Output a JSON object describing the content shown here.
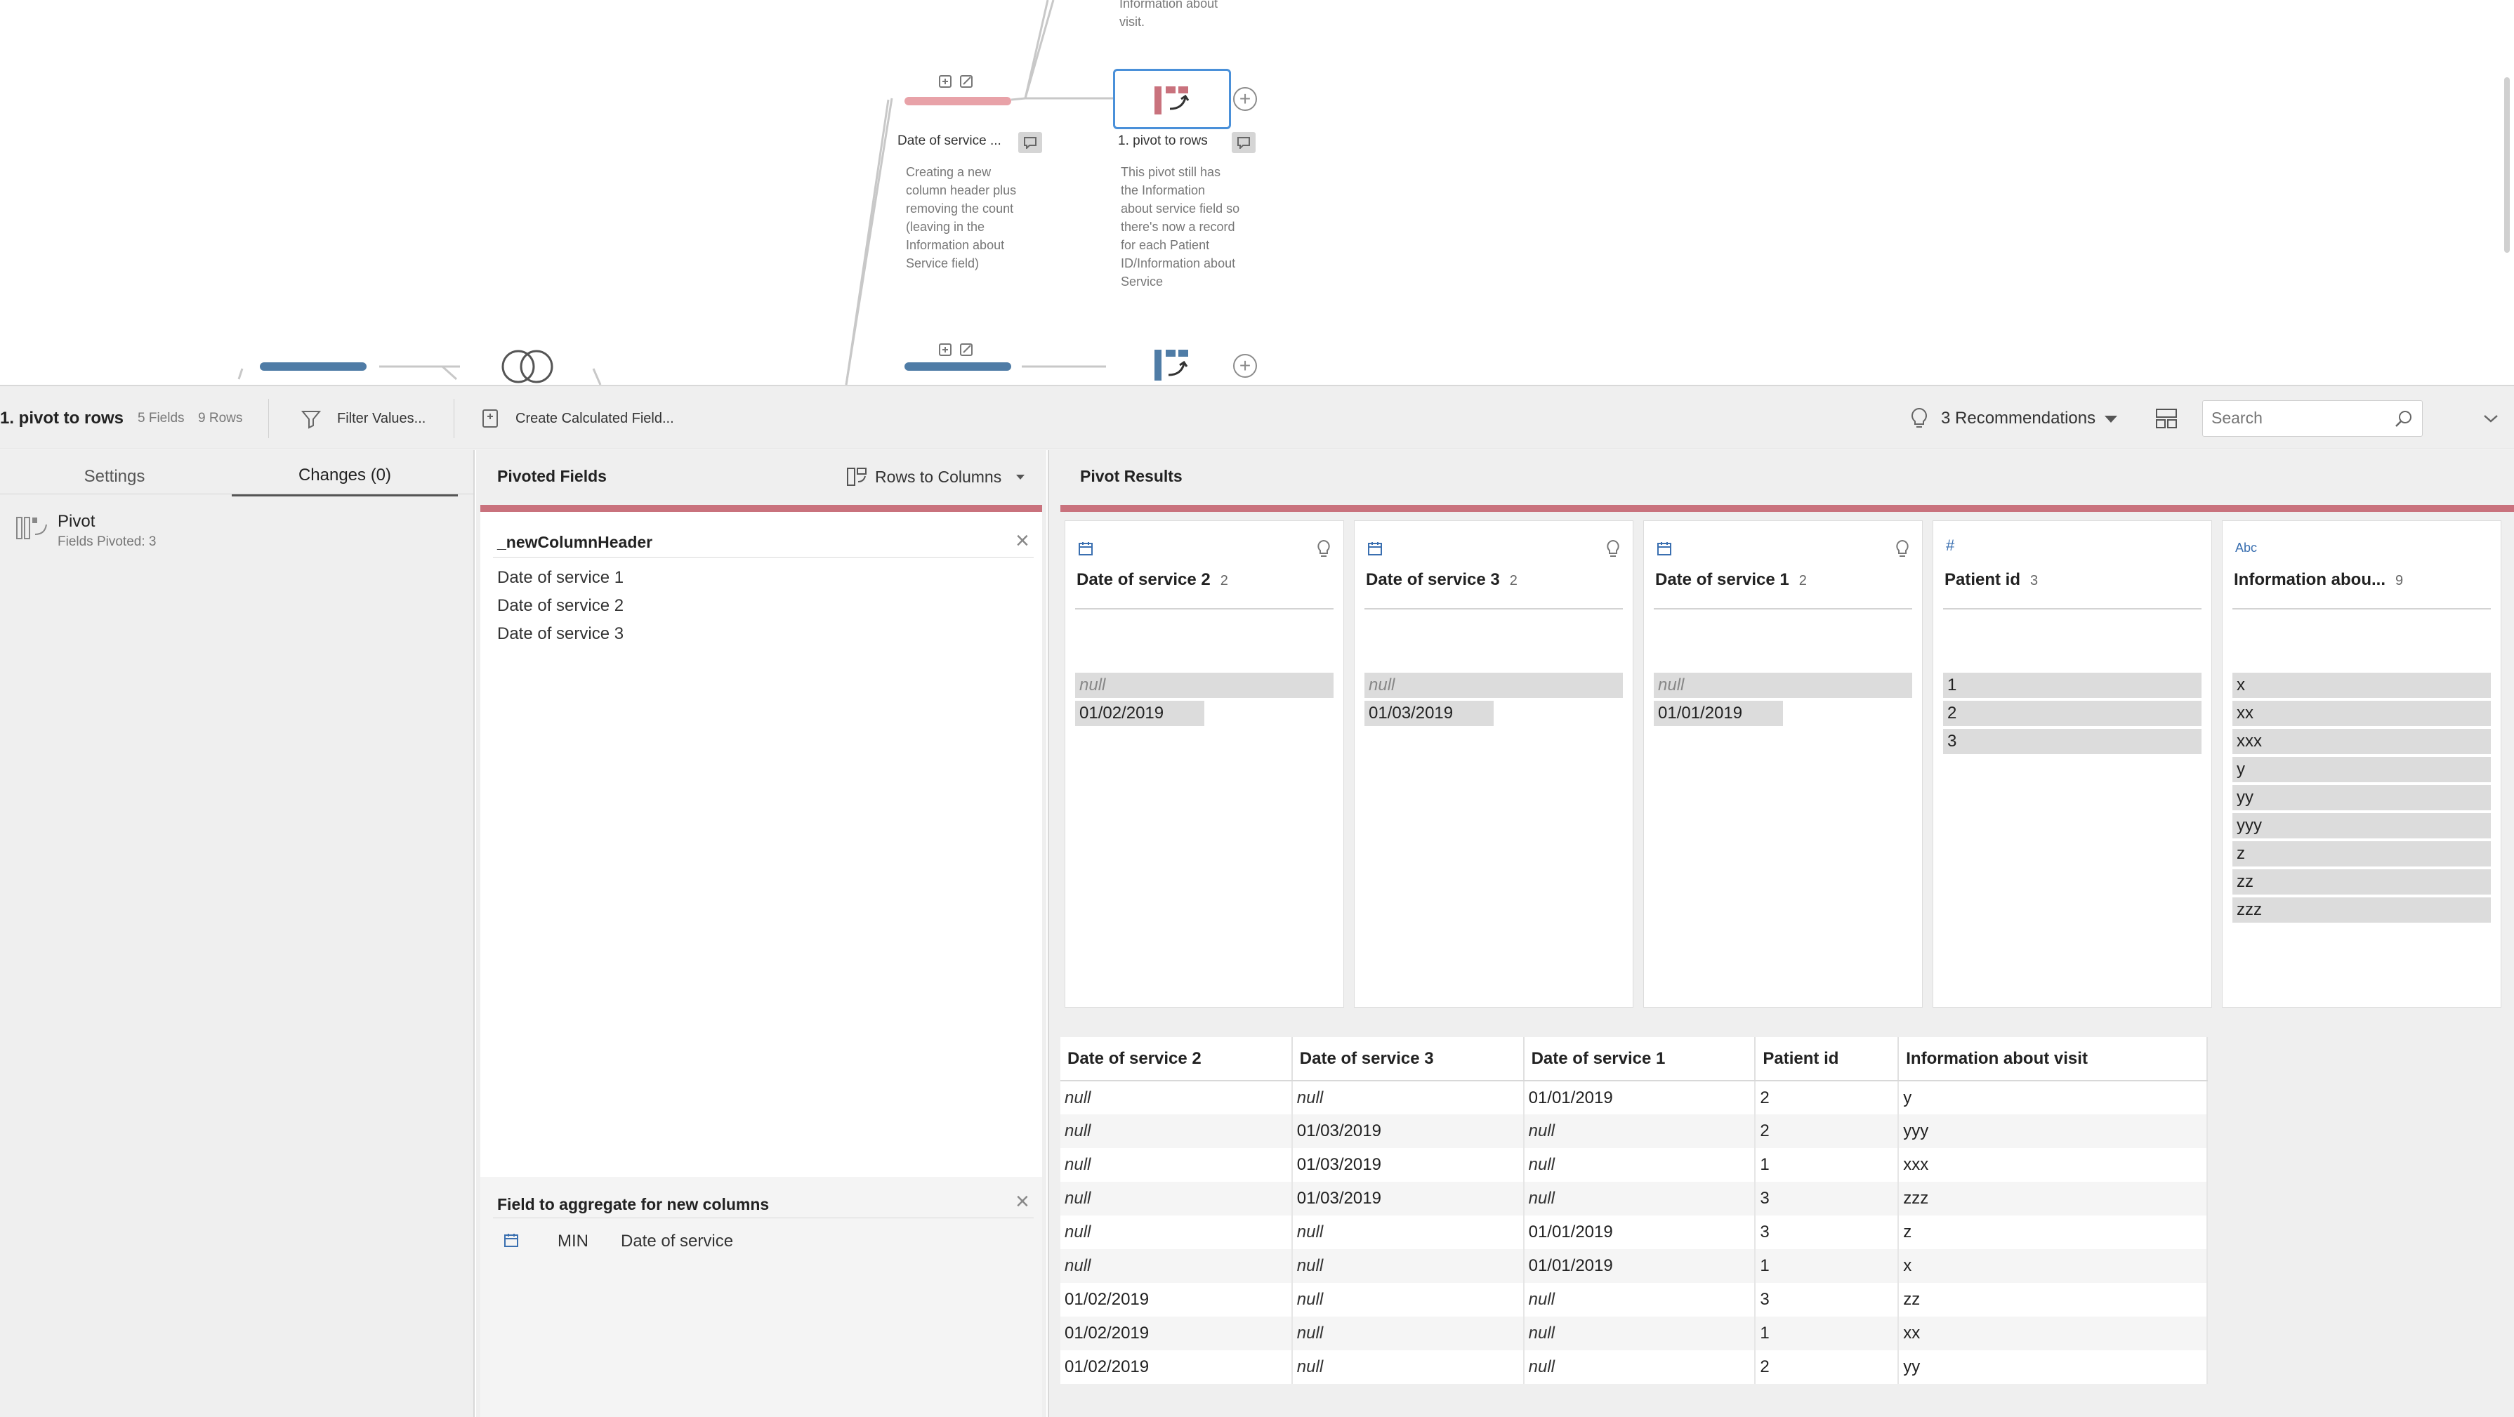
{
  "canvas": {
    "top_note": "Information about\nvisit.",
    "step1": {
      "label": "Date of service ...",
      "note": "Creating a new\ncolumn header plus\nremoving the count\n(leaving in the\nInformation about\nService field)"
    },
    "step2": {
      "label": "1. pivot to rows",
      "note": "This pivot still has\nthe Information\nabout service field so\nthere's now a record\nfor each Patient\nID/Information about\nService"
    }
  },
  "toolbar": {
    "step_name": "1. pivot to rows",
    "fields": "5 Fields",
    "rows": "9 Rows",
    "filter_label": "Filter Values...",
    "calc_label": "Create Calculated Field...",
    "recommendations_label": "3 Recommendations",
    "search_placeholder": "Search"
  },
  "left_panel": {
    "tabs": [
      "Settings",
      "Changes (0)"
    ],
    "active_tab": "Changes (0)",
    "change": {
      "title": "Pivot",
      "detail": "Fields Pivoted: 3"
    }
  },
  "mid_panel": {
    "title": "Pivoted Fields",
    "mode_label": "Rows to Columns",
    "header_field": "_newColumnHeader",
    "values": [
      "Date of service 1",
      "Date of service 2",
      "Date of service 3"
    ],
    "agg_title": "Field to aggregate for new columns",
    "agg": {
      "func": "MIN",
      "field": "Date of service"
    }
  },
  "right_panel": {
    "title": "Pivot Results",
    "cards": [
      {
        "type": "date",
        "name": "Date of service 2",
        "count": "2",
        "bulb": true,
        "values": [
          {
            "text": "null",
            "null": true,
            "fill": 1.0
          },
          {
            "text": "01/02/2019",
            "null": false,
            "fill": 0.5
          }
        ]
      },
      {
        "type": "date",
        "name": "Date of service 3",
        "count": "2",
        "bulb": true,
        "values": [
          {
            "text": "null",
            "null": true,
            "fill": 1.0
          },
          {
            "text": "01/03/2019",
            "null": false,
            "fill": 0.5
          }
        ]
      },
      {
        "type": "date",
        "name": "Date of service 1",
        "count": "2",
        "bulb": true,
        "values": [
          {
            "text": "null",
            "null": true,
            "fill": 1.0
          },
          {
            "text": "01/01/2019",
            "null": false,
            "fill": 0.5
          }
        ]
      },
      {
        "type": "number",
        "name": "Patient id",
        "count": "3",
        "bulb": false,
        "values": [
          {
            "text": "1",
            "null": false,
            "fill": 1.0
          },
          {
            "text": "2",
            "null": false,
            "fill": 1.0
          },
          {
            "text": "3",
            "null": false,
            "fill": 1.0
          }
        ]
      },
      {
        "type": "string",
        "name": "Information abou...",
        "count": "9",
        "bulb": false,
        "values": [
          {
            "text": "x",
            "null": false,
            "fill": 1.0
          },
          {
            "text": "xx",
            "null": false,
            "fill": 1.0
          },
          {
            "text": "xxx",
            "null": false,
            "fill": 1.0
          },
          {
            "text": "y",
            "null": false,
            "fill": 1.0
          },
          {
            "text": "yy",
            "null": false,
            "fill": 1.0
          },
          {
            "text": "yyy",
            "null": false,
            "fill": 1.0
          },
          {
            "text": "z",
            "null": false,
            "fill": 1.0
          },
          {
            "text": "zz",
            "null": false,
            "fill": 1.0
          },
          {
            "text": "zzz",
            "null": false,
            "fill": 1.0
          }
        ]
      }
    ],
    "table": {
      "columns": [
        "Date of service 2",
        "Date of service 3",
        "Date of service 1",
        "Patient id",
        "Information about visit"
      ],
      "rows": [
        [
          "null",
          "null",
          "01/01/2019",
          "2",
          "y"
        ],
        [
          "null",
          "01/03/2019",
          "null",
          "2",
          "yyy"
        ],
        [
          "null",
          "01/03/2019",
          "null",
          "1",
          "xxx"
        ],
        [
          "null",
          "01/03/2019",
          "null",
          "3",
          "zzz"
        ],
        [
          "null",
          "null",
          "01/01/2019",
          "3",
          "z"
        ],
        [
          "null",
          "null",
          "01/01/2019",
          "1",
          "x"
        ],
        [
          "01/02/2019",
          "null",
          "null",
          "3",
          "zz"
        ],
        [
          "01/02/2019",
          "null",
          "null",
          "1",
          "xx"
        ],
        [
          "01/02/2019",
          "null",
          "null",
          "2",
          "yy"
        ]
      ]
    }
  },
  "colors": {
    "accent_red": "#c9727d",
    "accent_blue": "#4f7ca6",
    "selected_border": "#4a90d9",
    "type_icon_blue": "#3a6fb0"
  }
}
